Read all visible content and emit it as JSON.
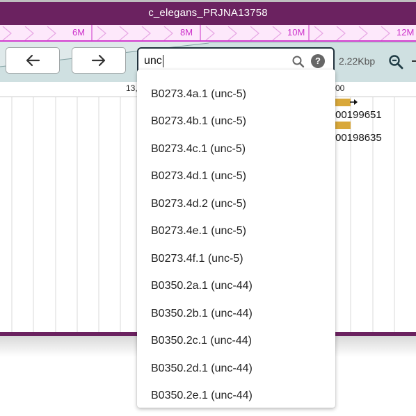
{
  "window": {
    "title": "c_elegans_PRJNA13758"
  },
  "overview": {
    "ticks": [
      "6M",
      "8M",
      "10M",
      "12M"
    ]
  },
  "toolbar": {
    "search": {
      "value": "unc"
    },
    "bp_size": "2.22Kbp"
  },
  "ruler": {
    "ticks": [
      "13,",
      "00"
    ]
  },
  "features": [
    {
      "label": "00199651"
    },
    {
      "label": "00198635"
    }
  ],
  "colors": {
    "title_bar": "#6b2260",
    "overview_accent": "#d23dcf",
    "nav_band": "#b9cfd0",
    "feature": "#d9a83a"
  },
  "icons": {
    "back": "arrow-left-icon",
    "forward": "arrow-right-icon",
    "search": "magnifier-icon",
    "help": "help-icon",
    "zoom": "zoom-out-icon"
  },
  "dropdown": {
    "items": [
      "B0273.4a.1 (unc-5)",
      "B0273.4b.1 (unc-5)",
      "B0273.4c.1 (unc-5)",
      "B0273.4d.1 (unc-5)",
      "B0273.4d.2 (unc-5)",
      "B0273.4e.1 (unc-5)",
      "B0273.4f.1 (unc-5)",
      "B0350.2a.1 (unc-44)",
      "B0350.2b.1 (unc-44)",
      "B0350.2c.1 (unc-44)",
      "B0350.2d.1 (unc-44)",
      "B0350.2e.1 (unc-44)"
    ]
  }
}
